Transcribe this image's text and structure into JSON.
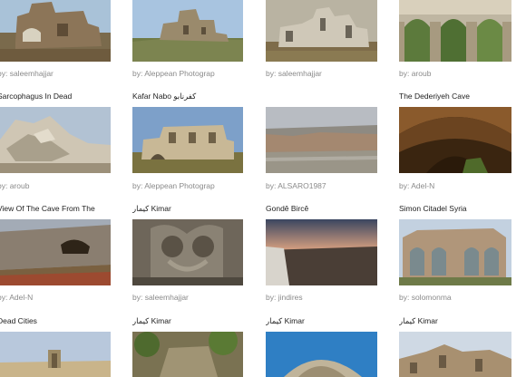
{
  "gallery": {
    "items": [
      {
        "title": "",
        "byline": "by: saleemhajjar"
      },
      {
        "title": "",
        "byline": "by: Aleppean Photograp"
      },
      {
        "title": "",
        "byline": "by: saleemhajjar"
      },
      {
        "title": "",
        "byline": "by: aroub"
      },
      {
        "title": "Sarcophagus In Dead",
        "byline": "by: aroub"
      },
      {
        "title": "Kafar Nabo كفرنابو",
        "byline": "by: Aleppean Photograp"
      },
      {
        "title": "",
        "byline": "by: ALSARO1987"
      },
      {
        "title": "The Dederiyeh Cave",
        "byline": "by: Adel-N"
      },
      {
        "title": "View Of The Cave From The",
        "byline": "by: Adel-N"
      },
      {
        "title": "كيمار Kimar",
        "byline": "by: saleemhajjar"
      },
      {
        "title": "Gondê Bircê",
        "byline": "by: jindires"
      },
      {
        "title": "Simon Citadel Syria",
        "byline": "by: solomonma"
      },
      {
        "title": "Dead Cities",
        "byline": ""
      },
      {
        "title": "كيمار Kimar",
        "byline": ""
      },
      {
        "title": "كيمار Kimar",
        "byline": ""
      },
      {
        "title": "كيمار Kimar",
        "byline": ""
      }
    ]
  }
}
